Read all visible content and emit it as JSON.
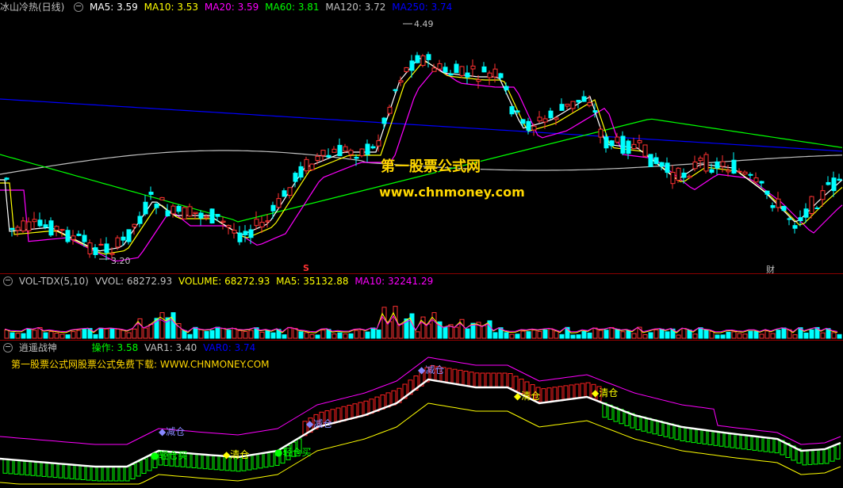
{
  "main": {
    "title": "冰山冷热(日线)",
    "ma": [
      {
        "label": "MA5: 3.59",
        "color": "#ffffff"
      },
      {
        "label": "MA10: 3.53",
        "color": "#ffff00"
      },
      {
        "label": "MA20: 3.59",
        "color": "#ff00ff"
      },
      {
        "label": "MA60: 3.81",
        "color": "#00ff00"
      },
      {
        "label": "MA120: 3.72",
        "color": "#c0c0c0"
      },
      {
        "label": "MA250: 3.74",
        "color": "#0000ff"
      }
    ],
    "high_label": "4.49",
    "low_label": "3.20",
    "s_marker": "S",
    "cai_marker": "财",
    "watermark_title": "第一股票公式网",
    "watermark_url": "www.chnmoney.com",
    "colors": {
      "up": "#ff3232",
      "down": "#00ffff"
    }
  },
  "volume": {
    "title": "VOL-TDX(5,10)",
    "values": [
      {
        "label": "VVOL: 68272.93",
        "color": "#c0c0c0"
      },
      {
        "label": "VOLUME: 68272.93",
        "color": "#ffff00"
      },
      {
        "label": "MA5: 35132.88",
        "color": "#ffff00"
      },
      {
        "label": "MA10: 32241.29",
        "color": "#ff00ff"
      }
    ]
  },
  "indicator": {
    "title": "逍遥战神",
    "values": [
      {
        "label": "操作: 3.58",
        "color": "#00ff00"
      },
      {
        "label": "VAR1: 3.40",
        "color": "#c0c0c0"
      },
      {
        "label": "VAR0: 3.74",
        "color": "#0000ff"
      }
    ],
    "subtitle": "第一股票公式网股票公式免费下载: WWW.CHNMONEY.COM",
    "signals": {
      "reduce1": "减仓",
      "reduce2": "减仓",
      "reduce3": "减仓",
      "buy1": "轻仓买",
      "buy2": "轻仓买",
      "clear1": "清仓",
      "clear2": "清仓",
      "clear3": "清仓"
    }
  }
}
